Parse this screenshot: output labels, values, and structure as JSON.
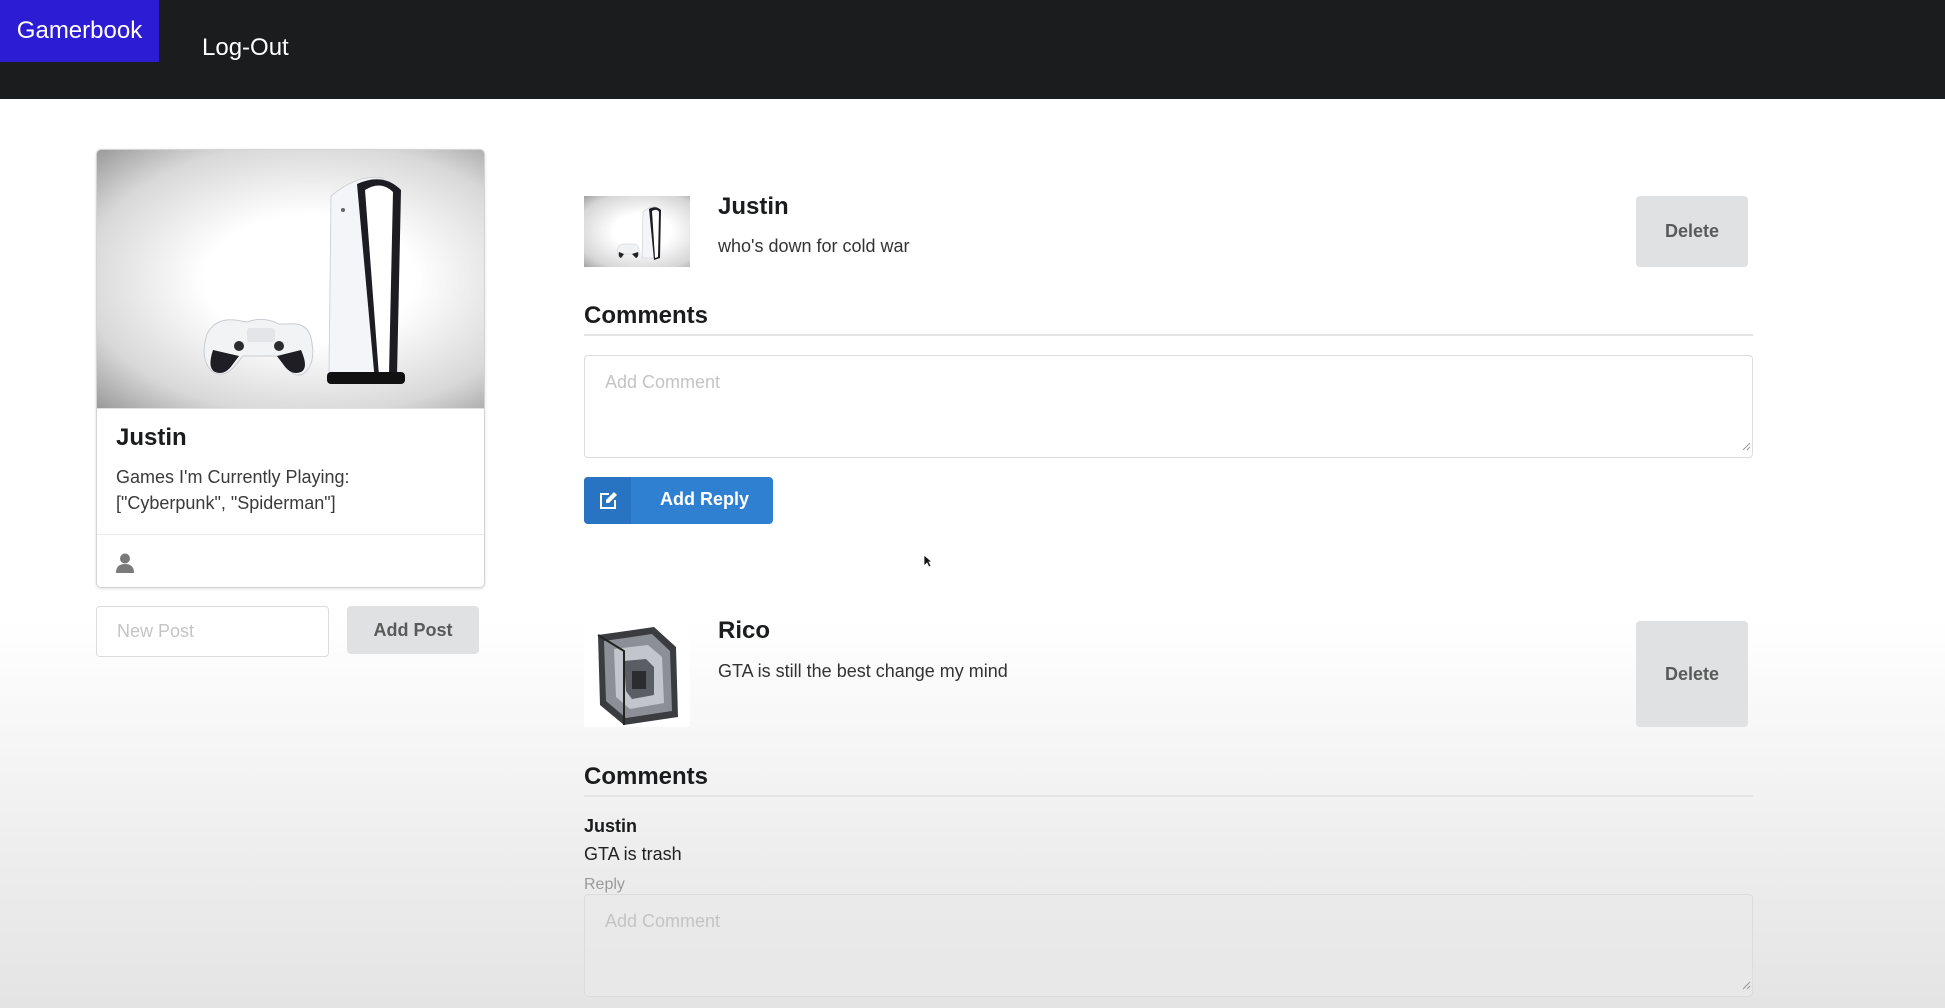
{
  "nav": {
    "brand": "Gamerbook",
    "logout": "Log-Out"
  },
  "profile": {
    "name": "Justin",
    "description": "Games I'm Currently Playing: [\"Cyberpunk\", \"Spiderman\"]",
    "new_post_placeholder": "New Post",
    "add_post_label": "Add Post"
  },
  "posts": [
    {
      "author": "Justin",
      "text": "who's down for cold war",
      "delete_label": "Delete",
      "comments_heading": "Comments",
      "comment_placeholder": "Add Comment",
      "add_reply_label": "Add Reply"
    },
    {
      "author": "Rico",
      "text": "GTA is still the best change my mind",
      "delete_label": "Delete",
      "comments_heading": "Comments",
      "comments": [
        {
          "author": "Justin",
          "text": "GTA is trash",
          "reply_label": "Reply"
        }
      ],
      "comment_placeholder": "Add Comment"
    }
  ],
  "colors": {
    "topbar": "#1b1c1d",
    "brand": "#2c1cd4",
    "primary_button": "#2f80d0",
    "gray_button": "#e0e1e2"
  }
}
